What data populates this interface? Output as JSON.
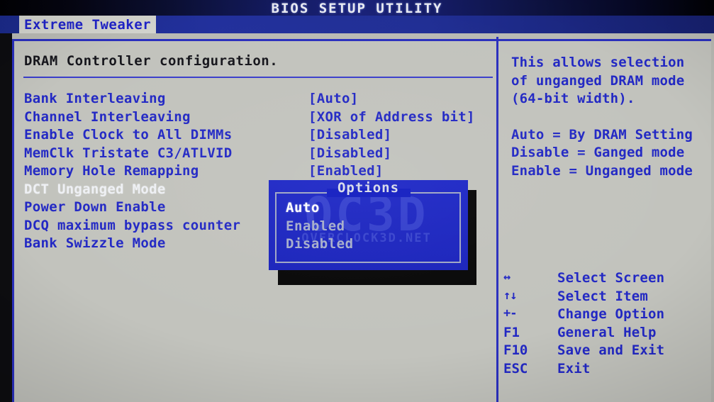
{
  "header": {
    "title": "BIOS SETUP UTILITY"
  },
  "tabs": {
    "active": "Extreme Tweaker"
  },
  "main": {
    "section_title": "DRAM Controller configuration.",
    "items": [
      {
        "label": "Bank Interleaving",
        "value": "[Auto]",
        "selected": false
      },
      {
        "label": "Channel Interleaving",
        "value": "[XOR of Address bit]",
        "selected": false
      },
      {
        "label": "Enable Clock to All DIMMs",
        "value": "[Disabled]",
        "selected": false
      },
      {
        "label": "MemClk Tristate C3/ATLVID",
        "value": "[Disabled]",
        "selected": false
      },
      {
        "label": "Memory Hole Remapping",
        "value": "[Enabled]",
        "selected": false
      },
      {
        "label": "DCT Unganged Mode",
        "value": "",
        "selected": true
      },
      {
        "label": "Power Down Enable",
        "value": "",
        "selected": false
      },
      {
        "label": "DCQ maximum bypass counter",
        "value": "",
        "selected": false
      },
      {
        "label": "Bank Swizzle Mode",
        "value": "",
        "selected": false
      }
    ]
  },
  "dialog": {
    "title": "Options",
    "options": [
      {
        "label": "Auto",
        "active": true
      },
      {
        "label": "Enabled",
        "active": false
      },
      {
        "label": "Disabled",
        "active": false
      }
    ],
    "watermark_big": "OC3D",
    "watermark_small": "OVERCLOCK3D.NET"
  },
  "help": {
    "lines": [
      "This allows selection",
      "of unganged DRAM mode",
      " (64-bit width).",
      "",
      "Auto = By DRAM Setting",
      "Disable = Ganged mode",
      "Enable = Unganged mode"
    ]
  },
  "legend": {
    "rows": [
      {
        "key": "↔",
        "desc": "Select Screen",
        "symbol": true
      },
      {
        "key": "↑↓",
        "desc": "Select Item",
        "symbol": true
      },
      {
        "key": "+-",
        "desc": "Change Option",
        "symbol": true
      },
      {
        "key": "F1",
        "desc": "General Help",
        "symbol": false
      },
      {
        "key": "F10",
        "desc": "Save and Exit",
        "symbol": false
      },
      {
        "key": "ESC",
        "desc": "Exit",
        "symbol": false
      }
    ]
  },
  "colors": {
    "screen_bg": "#b9bab4",
    "text_blue": "#2228c4",
    "title_black": "#16161c",
    "selected_white": "#eef0f4",
    "dialog_blue": "#1b26c0",
    "frame_blue": "#2a2fbe"
  }
}
